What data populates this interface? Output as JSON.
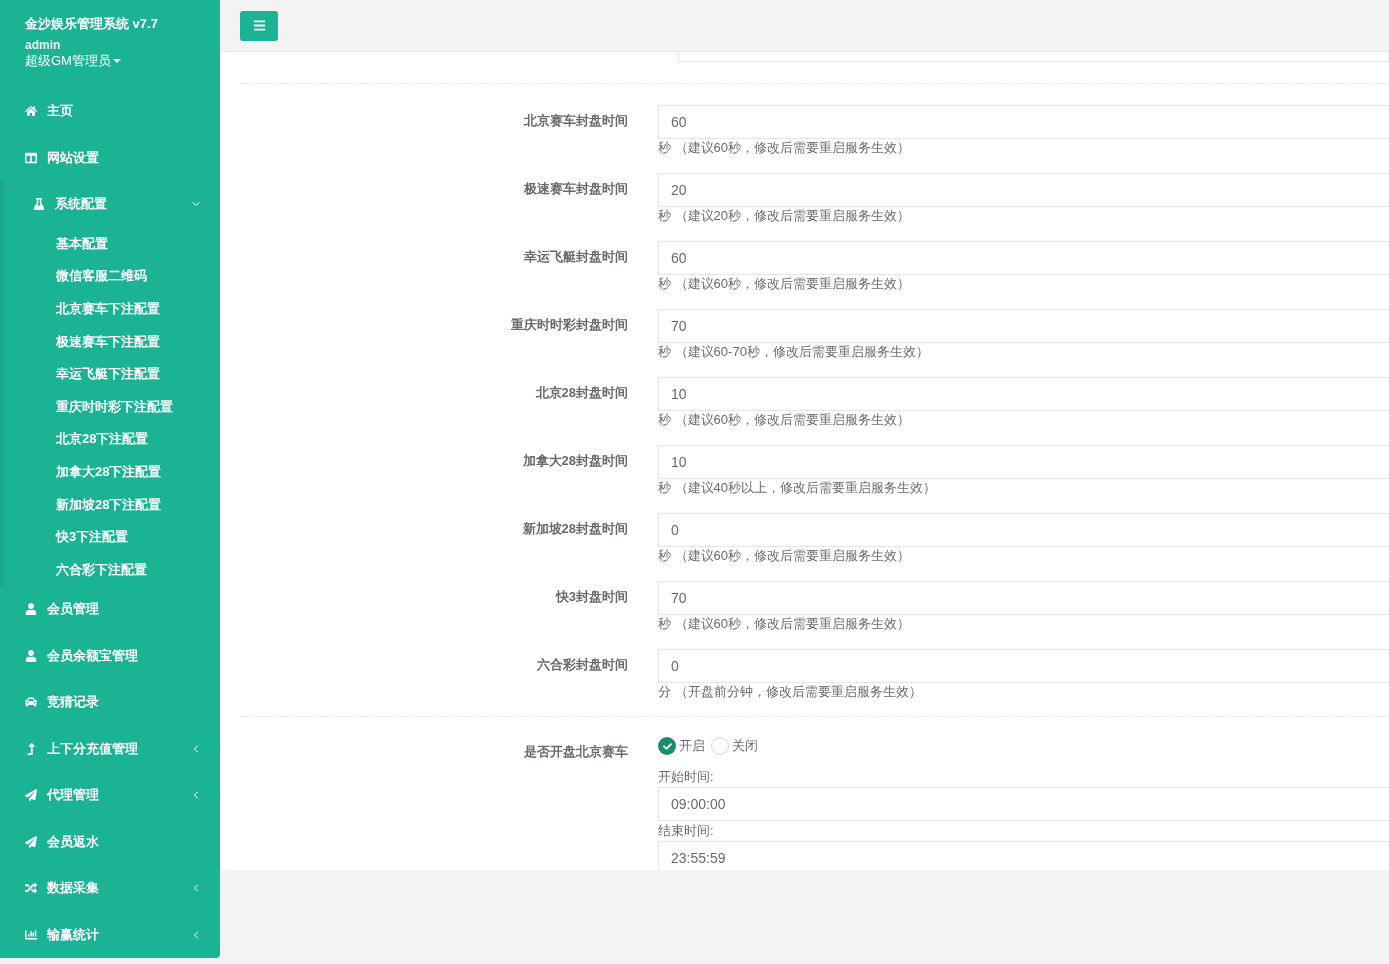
{
  "sidebar": {
    "title": "金沙娱乐管理系统 v7.7",
    "user": "admin",
    "role": "超级GM管理员",
    "items": [
      {
        "label": "主页",
        "kind": "link"
      },
      {
        "label": "网站设置",
        "kind": "link"
      },
      {
        "label": "系统配置",
        "kind": "menu",
        "expanded": true,
        "children": [
          {
            "label": "基本配置"
          },
          {
            "label": "微信客服二维码"
          },
          {
            "label": "北京赛车下注配置"
          },
          {
            "label": "极速赛车下注配置"
          },
          {
            "label": "幸运飞艇下注配置"
          },
          {
            "label": "重庆时时彩下注配置"
          },
          {
            "label": "北京28下注配置"
          },
          {
            "label": "加拿大28下注配置"
          },
          {
            "label": "新加坡28下注配置"
          },
          {
            "label": "快3下注配置"
          },
          {
            "label": "六合彩下注配置"
          }
        ]
      },
      {
        "label": "会员管理",
        "kind": "link"
      },
      {
        "label": "会员余额宝管理",
        "kind": "link"
      },
      {
        "label": "竞猜记录",
        "kind": "link"
      },
      {
        "label": "上下分充值管理",
        "kind": "menu",
        "expanded": false
      },
      {
        "label": "代理管理",
        "kind": "menu",
        "expanded": false
      },
      {
        "label": "会员返水",
        "kind": "link"
      },
      {
        "label": "数据采集",
        "kind": "menu",
        "expanded": false
      },
      {
        "label": "输赢统计",
        "kind": "menu",
        "expanded": false
      }
    ]
  },
  "form": {
    "fields": [
      {
        "label": "北京赛车封盘时间",
        "value": "60",
        "hint": "秒 （建议60秒，修改后需要重启服务生效）"
      },
      {
        "label": "极速赛车封盘时间",
        "value": "20",
        "hint": "秒 （建议20秒，修改后需要重启服务生效）"
      },
      {
        "label": "幸运飞艇封盘时间",
        "value": "60",
        "hint": "秒 （建议60秒，修改后需要重启服务生效）"
      },
      {
        "label": "重庆时时彩封盘时间",
        "value": "70",
        "hint": "秒 （建议60-70秒，修改后需要重启服务生效）"
      },
      {
        "label": "北京28封盘时间",
        "value": "10",
        "hint": "秒 （建议60秒，修改后需要重启服务生效）"
      },
      {
        "label": "加拿大28封盘时间",
        "value": "10",
        "hint": "秒 （建议40秒以上，修改后需要重启服务生效）"
      },
      {
        "label": "新加坡28封盘时间",
        "value": "0",
        "hint": "秒 （建议60秒，修改后需要重启服务生效）"
      },
      {
        "label": "快3封盘时间",
        "value": "70",
        "hint": "秒 （建议60秒，修改后需要重启服务生效）"
      },
      {
        "label": "六合彩封盘时间",
        "value": "0",
        "hint": "分 （开盘前分钟，修改后需要重启服务生效）"
      }
    ],
    "toggle": {
      "label": "是否开盘北京赛车",
      "options": [
        {
          "label": "开启",
          "selected": true
        },
        {
          "label": "关闭",
          "selected": false
        }
      ],
      "times": [
        {
          "label": "开始时间:",
          "value": "09:00:00"
        },
        {
          "label": "结束时间:",
          "value": "23:55:59"
        }
      ]
    }
  }
}
